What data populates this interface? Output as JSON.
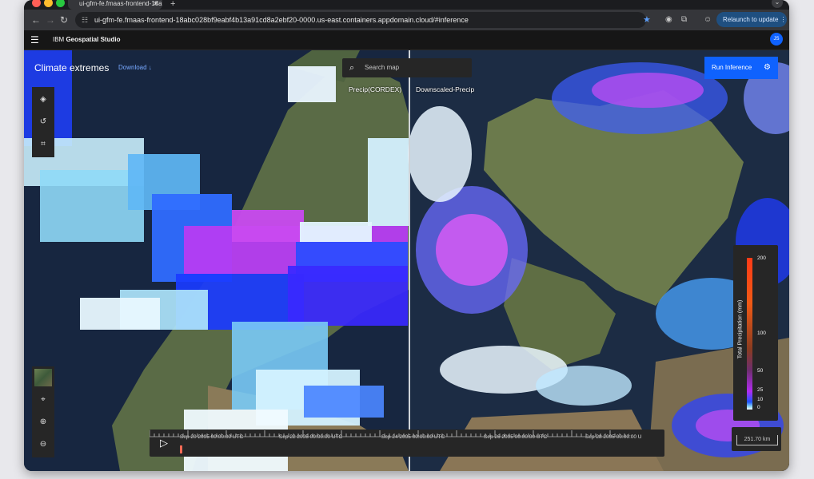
{
  "browser": {
    "tab_title": "ui-gfm-fe.fmaas-frontend-18a",
    "tab_close": "✕",
    "new_tab": "+",
    "tab_menu": "⌄",
    "url": "ui-gfm-fe.fmaas-frontend-18abc028bf9eabf4b13a91cd8a2ebf20-0000.us-east.containers.appdomain.cloud/#inference",
    "relaunch_label": "Relaunch to update ⋮",
    "profile_initials": "JS"
  },
  "app": {
    "brand_prefix": "IBM ",
    "brand_name": "Geospatial Studio",
    "avatar": "JS"
  },
  "map": {
    "title": "Climate extremes",
    "download_label": "Download ↓",
    "search_placeholder": "Search map",
    "run_inference_label": "Run Inference",
    "left_label": "Precip(CORDEX)",
    "right_label": "Downscaled-Precip"
  },
  "legend": {
    "title": "Total Precipitation (mm)",
    "ticks": [
      "200",
      "100",
      "50",
      "25",
      "10",
      "0"
    ]
  },
  "scale": {
    "label": "251.70 km"
  },
  "timeline": {
    "labels": [
      "Sep 20 2095 00:00:00 UTC",
      "Sep 22 2095 00:00:00 UTC",
      "Sep 24 2095 00:00:00 UTC",
      "Sep 26 2095 00:00:00 UTC",
      "Sep 28 2095 00:00:00 U"
    ]
  },
  "colors": {
    "accent": "#0f62fe",
    "panel": "#262626",
    "link": "#78a9ff"
  }
}
